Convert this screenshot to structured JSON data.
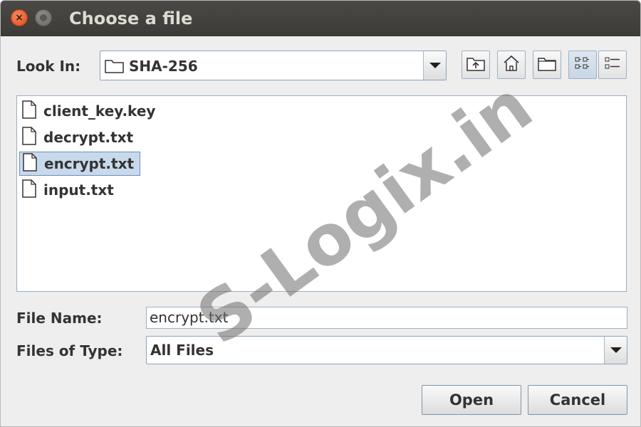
{
  "window": {
    "title": "Choose a file"
  },
  "look_in": {
    "label": "Look In:",
    "value": "SHA-256"
  },
  "toolbar": {
    "icons": [
      "up-folder-icon",
      "home-icon",
      "new-folder-icon",
      "list-view-icon",
      "details-view-icon"
    ]
  },
  "files": [
    {
      "name": "client_key.key",
      "selected": false
    },
    {
      "name": "decrypt.txt",
      "selected": false
    },
    {
      "name": "encrypt.txt",
      "selected": true
    },
    {
      "name": "input.txt",
      "selected": false
    }
  ],
  "file_name": {
    "label": "File Name:",
    "value": "encrypt.txt"
  },
  "files_of_type": {
    "label": "Files of Type:",
    "value": "All Files"
  },
  "buttons": {
    "open": "Open",
    "cancel": "Cancel"
  },
  "watermark": "S-Logix.in",
  "colors": {
    "selection": "#c9d9ec",
    "titlebar": "#3c3b37",
    "close_button": "#df4a16"
  }
}
